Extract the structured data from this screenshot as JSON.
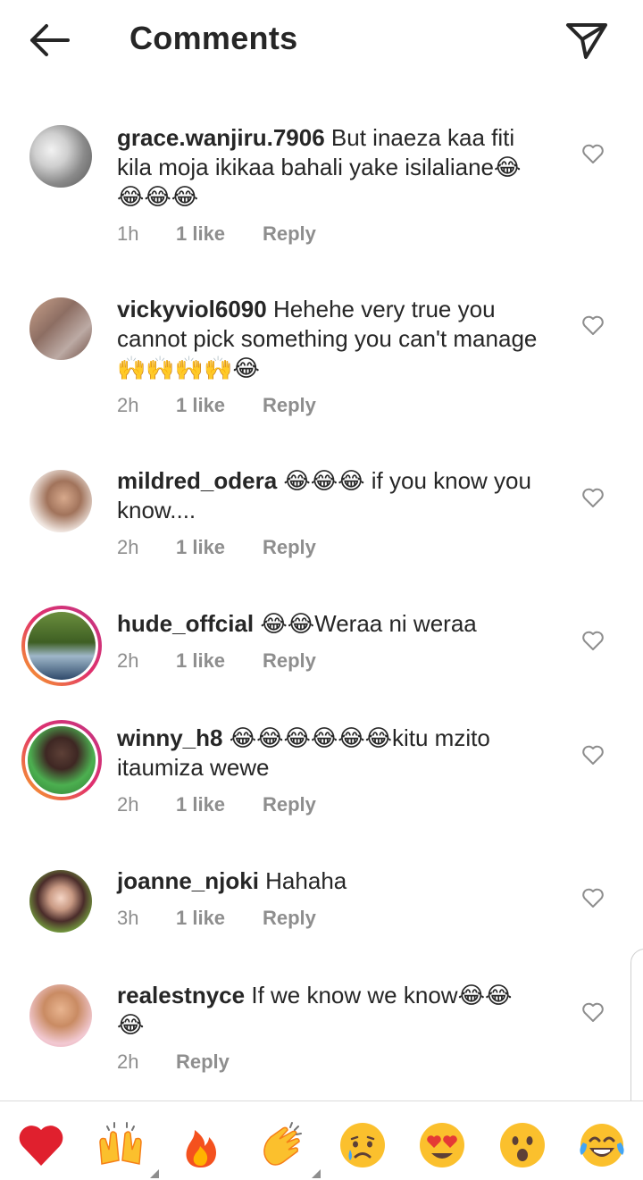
{
  "header": {
    "title": "Comments"
  },
  "comments": [
    {
      "username": "grace.wanjiru.7906",
      "text": "But inaeza kaa fiti kila moja ikikaa bahali yake isilaliane",
      "emoji_suffix": "😂",
      "emoji_line": "😂😂😂",
      "time": "1h",
      "likes": "1 like",
      "reply": "Reply"
    },
    {
      "username": "vickyviol6090",
      "text": "Hehehe very true  you cannot pick something you can't manage ",
      "emoji_suffix": "🙌🙌🙌🙌😂",
      "time": "2h",
      "likes": "1 like",
      "reply": "Reply"
    },
    {
      "username": "mildred_odera",
      "emoji_prefix": "😂😂😂",
      "text": " if you know you know....",
      "time": "2h",
      "likes": "1 like",
      "reply": "Reply"
    },
    {
      "username": "hude_offcial",
      "emoji_prefix": "😂😂",
      "text": "Weraa ni weraa",
      "time": "2h",
      "likes": "1 like",
      "reply": "Reply"
    },
    {
      "username": "winny_h8",
      "emoji_prefix": "😂😂😂😂😂😂",
      "text": "kitu mzito itaumiza wewe",
      "time": "2h",
      "likes": "1 like",
      "reply": "Reply"
    },
    {
      "username": "joanne_njoki",
      "text": "Hahaha",
      "time": "3h",
      "likes": "1 like",
      "reply": "Reply"
    },
    {
      "username": "realestnyce",
      "text": "If we know we know",
      "emoji_suffix": "😂😂",
      "emoji_line": "😂",
      "time": "2h",
      "reply": "Reply"
    }
  ],
  "quick_reactions": [
    "heart-emoji",
    "raising-hands-emoji",
    "fire-emoji",
    "clapping-emoji",
    "crying-emoji",
    "heart-eyes-emoji",
    "surprised-emoji",
    "laughing-tears-emoji"
  ],
  "colors": {
    "text": "#262626",
    "secondary": "#8e8e8e",
    "heart": "#ed2e3c"
  }
}
